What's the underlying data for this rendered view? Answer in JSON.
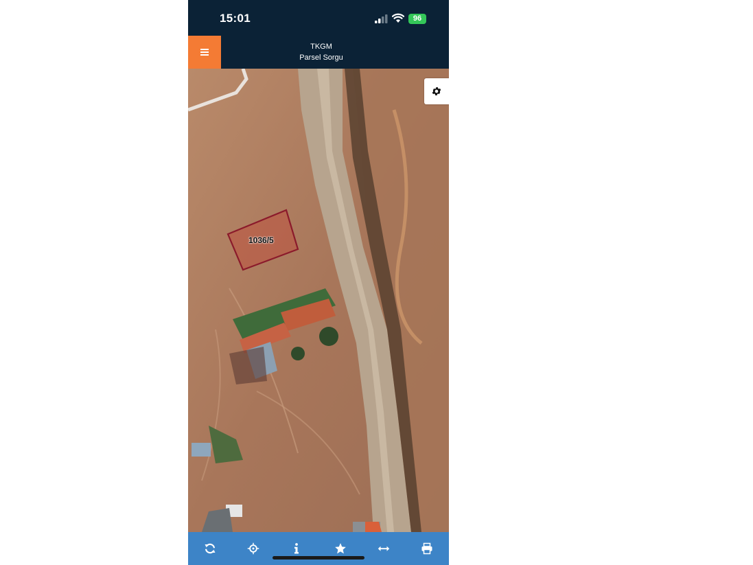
{
  "status_bar": {
    "time": "15:01",
    "battery": "96"
  },
  "header": {
    "title": "TKGM",
    "subtitle": "Parsel Sorgu",
    "menu_icon": "menu-icon",
    "menu_color": "#f47b34",
    "background_color": "#0b2236"
  },
  "map": {
    "parcel_label": "1036/5",
    "parcel_outline_color": "#8b1a2b",
    "settings_icon": "gear-icon"
  },
  "toolbar": {
    "background_color": "#3d84c7",
    "items": [
      {
        "name": "refresh",
        "icon": "refresh-icon"
      },
      {
        "name": "locate",
        "icon": "crosshair-icon"
      },
      {
        "name": "info",
        "icon": "info-icon"
      },
      {
        "name": "favorites",
        "icon": "star-icon"
      },
      {
        "name": "measure",
        "icon": "measure-icon"
      },
      {
        "name": "print",
        "icon": "print-icon"
      }
    ]
  }
}
